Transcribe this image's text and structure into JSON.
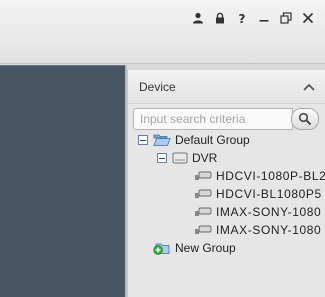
{
  "panel": {
    "title": "Device"
  },
  "search": {
    "placeholder": "Input search criteria"
  },
  "tree": {
    "group": "Default Group",
    "device": "DVR",
    "cameras": [
      "HDCVI-1080P-BL2",
      "HDCVI-BL1080P5",
      "IMAX-SONY-1080",
      "IMAX-SONY-1080"
    ],
    "new_group": "New Group"
  },
  "icons": {
    "user": "user-icon",
    "lock": "lock-icon",
    "help": "help-icon",
    "minimize": "minimize-icon",
    "restore": "restore-icon",
    "close": "close-icon",
    "collapse": "chevron-up-icon",
    "search": "search-icon",
    "folder": "folder-open-icon",
    "dvr": "dvr-icon",
    "camera": "camera-icon",
    "add": "add-group-icon"
  }
}
